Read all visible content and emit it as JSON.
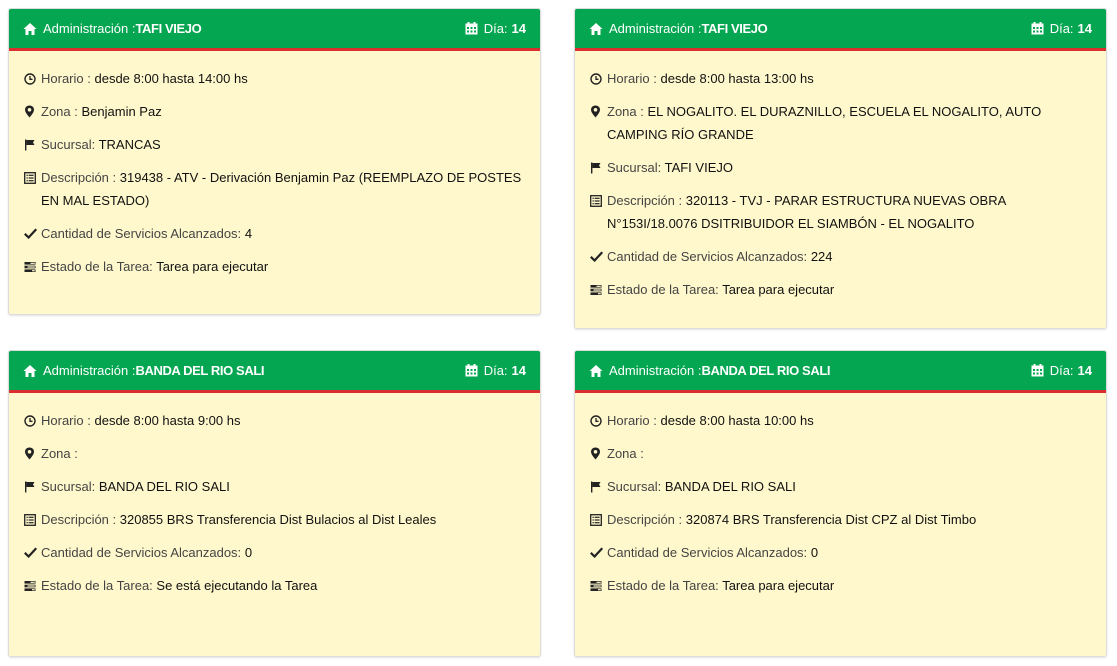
{
  "cards": [
    {
      "header_label": "Administración :",
      "header_place": "TAFI VIEJO",
      "dia_label": "Día:",
      "dia_value": "14",
      "horario_label": "Horario :",
      "horario_value": "desde 8:00 hasta 14:00 hs",
      "zona_label": "Zona :",
      "zona_value": "Benjamin Paz",
      "sucursal_label": "Sucursal:",
      "sucursal_value": "TRANCAS",
      "descripcion_label": "Descripción :",
      "descripcion_value": "319438 - ATV - Derivación Benjamin Paz (REEMPLAZO DE POSTES EN MAL ESTADO)",
      "servicios_label": "Cantidad de Servicios Alcanzados:",
      "servicios_value": "4",
      "estado_label": "Estado de la Tarea:",
      "estado_value": "Tarea para ejecutar"
    },
    {
      "header_label": "Administración :",
      "header_place": "TAFI VIEJO",
      "dia_label": "Día:",
      "dia_value": "14",
      "horario_label": "Horario :",
      "horario_value": "desde 8:00 hasta 13:00 hs",
      "zona_label": "Zona :",
      "zona_value": "EL NOGALITO. EL DURAZNILLO, ESCUELA EL NOGALITO, AUTO CAMPING RÍO GRANDE",
      "sucursal_label": "Sucursal:",
      "sucursal_value": "TAFI VIEJO",
      "descripcion_label": "Descripción :",
      "descripcion_value": "320113 - TVJ - PARAR ESTRUCTURA NUEVAS OBRA N°153I/18.0076 DSITRIBUIDOR EL SIAMBÓN - EL NOGALITO",
      "servicios_label": "Cantidad de Servicios Alcanzados:",
      "servicios_value": "224",
      "estado_label": "Estado de la Tarea:",
      "estado_value": "Tarea para ejecutar"
    },
    {
      "header_label": "Administración :",
      "header_place": "BANDA DEL RIO SALI",
      "dia_label": "Día:",
      "dia_value": "14",
      "horario_label": "Horario :",
      "horario_value": "desde 8:00 hasta 9:00 hs",
      "zona_label": "Zona :",
      "zona_value": "",
      "sucursal_label": "Sucursal:",
      "sucursal_value": "BANDA DEL RIO SALI",
      "descripcion_label": "Descripción :",
      "descripcion_value": "320855 BRS Transferencia Dist Bulacios al Dist Leales",
      "servicios_label": "Cantidad de Servicios Alcanzados:",
      "servicios_value": "0",
      "estado_label": "Estado de la Tarea:",
      "estado_value": "Se está ejecutando la Tarea"
    },
    {
      "header_label": "Administración :",
      "header_place": "BANDA DEL RIO SALI",
      "dia_label": "Día:",
      "dia_value": "14",
      "horario_label": "Horario :",
      "horario_value": "desde 8:00 hasta 10:00 hs",
      "zona_label": "Zona :",
      "zona_value": "",
      "sucursal_label": "Sucursal:",
      "sucursal_value": "BANDA DEL RIO SALI",
      "descripcion_label": "Descripción :",
      "descripcion_value": "320874 BRS Transferencia Dist CPZ al Dist Timbo",
      "servicios_label": "Cantidad de Servicios Alcanzados:",
      "servicios_value": "0",
      "estado_label": "Estado de la Tarea:",
      "estado_value": "Tarea para ejecutar"
    }
  ],
  "colors": {
    "header_green": "#04a651",
    "header_border_red": "#d9302f",
    "card_background": "#fff8cc"
  },
  "icons": {
    "header": [
      "home-icon",
      "calendar-icon"
    ],
    "rows": [
      "clock-icon",
      "map-marker-icon",
      "flag-icon",
      "list-alt-icon",
      "check-icon",
      "tasks-icon"
    ]
  }
}
